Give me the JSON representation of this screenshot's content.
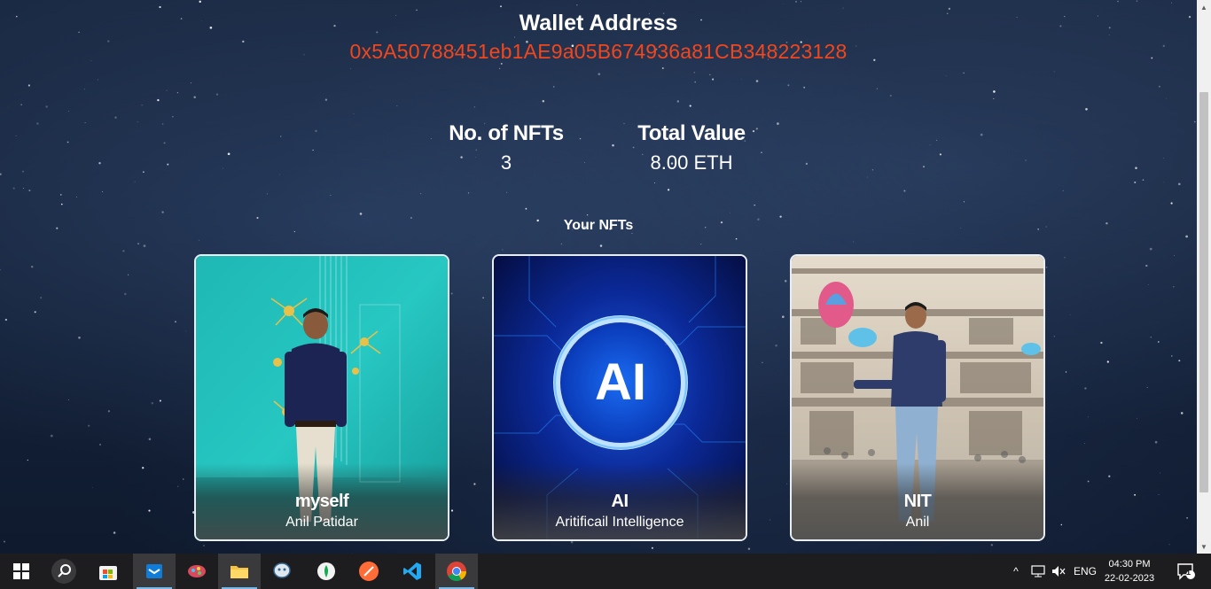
{
  "wallet": {
    "title": "Wallet Address",
    "address": "0x5A50788451eb1AE9a05B674936a81CB348223128"
  },
  "stats": {
    "nfts_label": "No. of NFTs",
    "nfts_value": "3",
    "total_label": "Total Value",
    "total_value": "8.00 ETH"
  },
  "section_title": "Your NFTs",
  "nfts": [
    {
      "name": "myself",
      "description": "Anil Patidar"
    },
    {
      "name": "AI",
      "description": "Aritificail Intelligence",
      "art_text": "AI"
    },
    {
      "name": "NIT",
      "description": "Anil"
    }
  ],
  "taskbar": {
    "apps": [
      "start-icon",
      "search-icon",
      "store-icon",
      "outlook-icon",
      "paint-icon",
      "file-explorer-icon",
      "pgadmin-icon",
      "mongodb-compass-icon",
      "postman-icon",
      "vscode-icon",
      "chrome-icon"
    ],
    "language": "ENG",
    "time": "04:30 PM",
    "date": "22-02-2023",
    "notification_count": "1"
  },
  "colors": {
    "address": "#f2461c",
    "taskbar": "#1d1d1f"
  }
}
